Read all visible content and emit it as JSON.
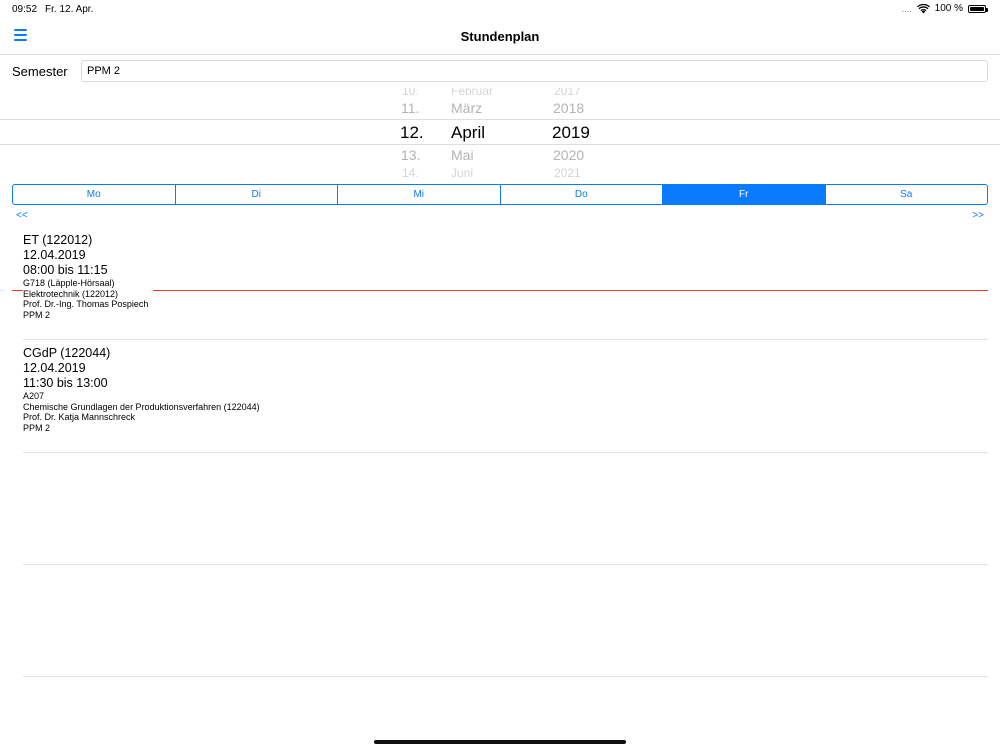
{
  "status": {
    "time": "09:52",
    "date": "Fr. 12. Apr.",
    "signal": "....",
    "battery": "100 %"
  },
  "nav": {
    "title": "Stundenplan",
    "menu_icon": "hamburger-menu-icon"
  },
  "semester": {
    "label": "Semester",
    "value": "PPM 2"
  },
  "picker": {
    "day": {
      "above2": "10.",
      "above": "11.",
      "selected": "12.",
      "below": "13.",
      "below2": "14."
    },
    "month": {
      "above2": "Februar",
      "above": "März",
      "selected": "April",
      "below": "Mai",
      "below2": "Juni"
    },
    "year": {
      "above2": "2017",
      "above": "2018",
      "selected": "2019",
      "below": "2020",
      "below2": "2021"
    }
  },
  "weekdays": {
    "items": [
      {
        "label": "Mo",
        "active": false
      },
      {
        "label": "Di",
        "active": false
      },
      {
        "label": "Mi",
        "active": false
      },
      {
        "label": "Do",
        "active": false
      },
      {
        "label": "Fr",
        "active": true
      },
      {
        "label": "Sa",
        "active": false
      }
    ],
    "prev": "<<",
    "next": ">>"
  },
  "lessons": [
    {
      "title": "ET (122012)",
      "date": "12.04.2019",
      "time": "08:00 bis 11:15",
      "room": "G718 (Läpple-Hörsaal)",
      "course": "Elektrotechnik (122012)",
      "lecturer": "Prof. Dr.-Ing. Thomas Pospiech",
      "group": "PPM 2"
    },
    {
      "title": "CGdP (122044)",
      "date": "12.04.2019",
      "time": "11:30 bis 13:00",
      "room": "A207",
      "course": "Chemische Grundlagen der Produktionsverfahren (122044)",
      "lecturer": "Prof. Dr. Katja Mannschreck",
      "group": "PPM 2"
    }
  ],
  "colors": {
    "accent": "#0a7aff",
    "now_line": "#ff3b30"
  }
}
